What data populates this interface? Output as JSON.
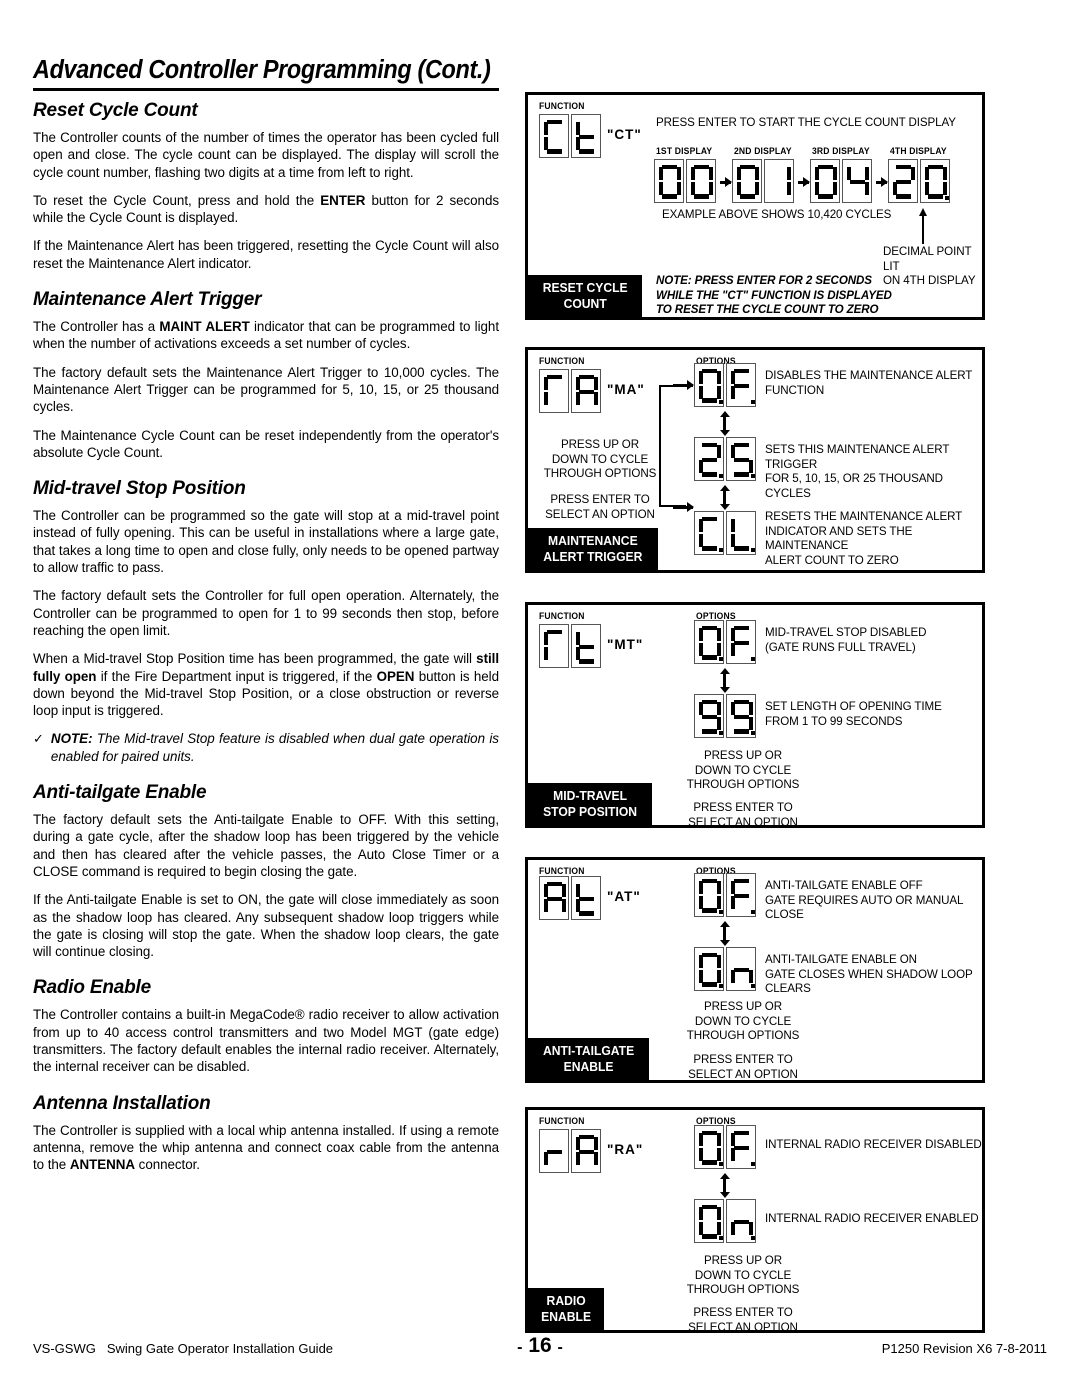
{
  "page": {
    "title": "Advanced Controller Programming (Cont.)"
  },
  "left_column": {
    "sections": [
      {
        "heading": "Reset Cycle Count",
        "paragraphs": [
          "The Controller counts of the number of times the operator has been cycled full open and close. The cycle count can be displayed. The display will scroll the cycle count number, flashing two digits at a time from left to right.",
          "To reset the Cycle Count, press and hold the ENTER button for 2 seconds while the Cycle Count is displayed.",
          "If the Maintenance Alert has been triggered, resetting the Cycle Count will also reset the Maintenance Alert indicator."
        ]
      },
      {
        "heading": "Maintenance Alert Trigger",
        "paragraphs": [
          "The Controller has a MAINT ALERT indicator that can be programmed to light when the number of activations exceeds a set number of cycles.",
          "The factory default sets the Maintenance Alert Trigger to 10,000 cycles. The Maintenance Alert Trigger can be programmed for 5, 10, 15, or 25 thousand cycles.",
          "The Maintenance Cycle Count can be reset independently from the operator's absolute Cycle Count."
        ]
      },
      {
        "heading": "Mid-travel Stop Position",
        "paragraphs": [
          "The Controller can be programmed so the gate will stop at a mid-travel point instead of fully opening. This can be useful in installations where a large gate, that takes a long time to open and close fully, only needs to be opened partway to allow traffic to pass.",
          "The factory default sets the Controller for full open operation. Alternately, the Controller can be programmed to open for 1 to 99 seconds then stop, before reaching the open limit.",
          "When a Mid-travel Stop Position time has been programmed, the gate will still fully open if the Fire Department input is triggered, if the OPEN button is held down beyond the Mid-travel Stop Position, or a close obstruction or reverse loop input is triggered."
        ],
        "note": {
          "check": "✓",
          "label": "NOTE:",
          "text": "The Mid-travel Stop feature is disabled when dual gate operation is enabled for paired units."
        }
      },
      {
        "heading": "Anti-tailgate Enable",
        "paragraphs": [
          "The factory default sets the Anti-tailgate Enable to OFF. With this setting, during a gate cycle, after the shadow loop has been triggered by the vehicle and then has cleared after the vehicle passes, the Auto Close Timer or a CLOSE command is required to begin closing the gate.",
          "If the Anti-tailgate Enable is set to ON, the gate will close immediately as soon as the shadow loop has cleared. Any subsequent shadow loop triggers while the gate is closing will stop the gate. When the shadow loop clears, the gate will continue closing."
        ]
      },
      {
        "heading": "Radio Enable",
        "paragraphs": [
          "The Controller contains a built-in MegaCode® radio receiver to allow activation from up to 40 access control transmitters and two Model MGT (gate edge) transmitters. The factory default enables the internal radio receiver. Alternately, the internal receiver can be disabled."
        ]
      },
      {
        "heading": "Antenna Installation",
        "paragraphs": [
          "The Controller is supplied with a local whip antenna installed. If using a remote antenna, remove the whip antenna and connect coax cable from the antenna to the ANTENNA connector."
        ]
      }
    ]
  },
  "diagrams": {
    "reset_cycle_count": {
      "function_label": "FUNCTION",
      "function_code": "CT",
      "function_quote": "\"CT\"",
      "instruction": "PRESS ENTER TO START THE CYCLE COUNT DISPLAY",
      "display_headers": [
        "1ST DISPLAY",
        "2ND DISPLAY",
        "3RD DISPLAY",
        "4TH DISPLAY"
      ],
      "display_values": [
        "00",
        "01",
        "04",
        "20"
      ],
      "example_caption": "EXAMPLE ABOVE SHOWS 10,420 CYCLES",
      "decimal_note": "DECIMAL POINT LIT\nON 4TH DISPLAY",
      "note": "NOTE: PRESS ENTER FOR 2 SECONDS\nWHILE THE \"CT\" FUNCTION IS DISPLAYED\nTO RESET THE CYCLE COUNT TO ZERO",
      "banner": [
        "RESET CYCLE",
        "COUNT"
      ]
    },
    "maintenance_alert_trigger": {
      "function_label": "FUNCTION",
      "options_label": "OPTIONS",
      "function_code": "MA",
      "function_quote": "\"MA\"",
      "options": [
        {
          "value": "OF",
          "description": "DISABLES THE MAINTENANCE ALERT\nFUNCTION"
        },
        {
          "value": "25",
          "description": "SETS THIS MAINTENANCE ALERT TRIGGER\nFOR 5, 10, 15, OR 25 THOUSAND CYCLES"
        },
        {
          "value": "CL",
          "description": "RESETS THE MAINTENANCE ALERT\nINDICATOR AND SETS THE MAINTENANCE\nALERT COUNT TO ZERO"
        }
      ],
      "hint_up_down": "PRESS UP OR\nDOWN TO CYCLE\nTHROUGH OPTIONS",
      "hint_enter": "PRESS ENTER TO\nSELECT AN OPTION",
      "banner": [
        "MAINTENANCE",
        "ALERT TRIGGER"
      ]
    },
    "mid_travel_stop_position": {
      "function_label": "FUNCTION",
      "options_label": "OPTIONS",
      "function_code": "MT",
      "function_quote": "\"MT\"",
      "options": [
        {
          "value": "OF",
          "description": "MID-TRAVEL STOP DISABLED\n(GATE RUNS FULL TRAVEL)"
        },
        {
          "value": "99",
          "description": "SET LENGTH OF OPENING TIME\nFROM 1 TO 99 SECONDS"
        }
      ],
      "hint_up_down": "PRESS UP OR\nDOWN TO CYCLE\nTHROUGH OPTIONS",
      "hint_enter": "PRESS ENTER TO\nSELECT AN OPTION",
      "banner": [
        "MID-TRAVEL",
        "STOP POSITION"
      ]
    },
    "anti_tailgate_enable": {
      "function_label": "FUNCTION",
      "options_label": "OPTIONS",
      "function_code": "AT",
      "function_quote": "\"AT\"",
      "options": [
        {
          "value": "OF",
          "description": "ANTI-TAILGATE ENABLE OFF\nGATE REQUIRES AUTO OR MANUAL CLOSE"
        },
        {
          "value": "ON",
          "description": "ANTI-TAILGATE ENABLE ON\nGATE CLOSES WHEN SHADOW LOOP CLEARS"
        }
      ],
      "hint_up_down": "PRESS UP OR\nDOWN TO CYCLE\nTHROUGH OPTIONS",
      "hint_enter": "PRESS ENTER TO\nSELECT AN OPTION",
      "banner": [
        "ANTI-TAILGATE",
        "ENABLE"
      ]
    },
    "radio_enable": {
      "function_label": "FUNCTION",
      "options_label": "OPTIONS",
      "function_code": "RA",
      "function_quote": "\"RA\"",
      "options": [
        {
          "value": "OF",
          "description": "INTERNAL RADIO RECEIVER DISABLED"
        },
        {
          "value": "ON",
          "description": "INTERNAL RADIO RECEIVER ENABLED"
        }
      ],
      "hint_up_down": "PRESS UP OR\nDOWN TO CYCLE\nTHROUGH OPTIONS",
      "hint_enter": "PRESS ENTER TO\nSELECT AN OPTION",
      "banner": [
        "RADIO",
        "ENABLE"
      ]
    }
  },
  "footer": {
    "model": "VS-GSWG",
    "guide": "Swing Gate Operator Installation Guide",
    "page_number": "16",
    "dash_left": "-",
    "dash_right": "-",
    "revision": "P1250 Revision X6 7-8-2011"
  }
}
